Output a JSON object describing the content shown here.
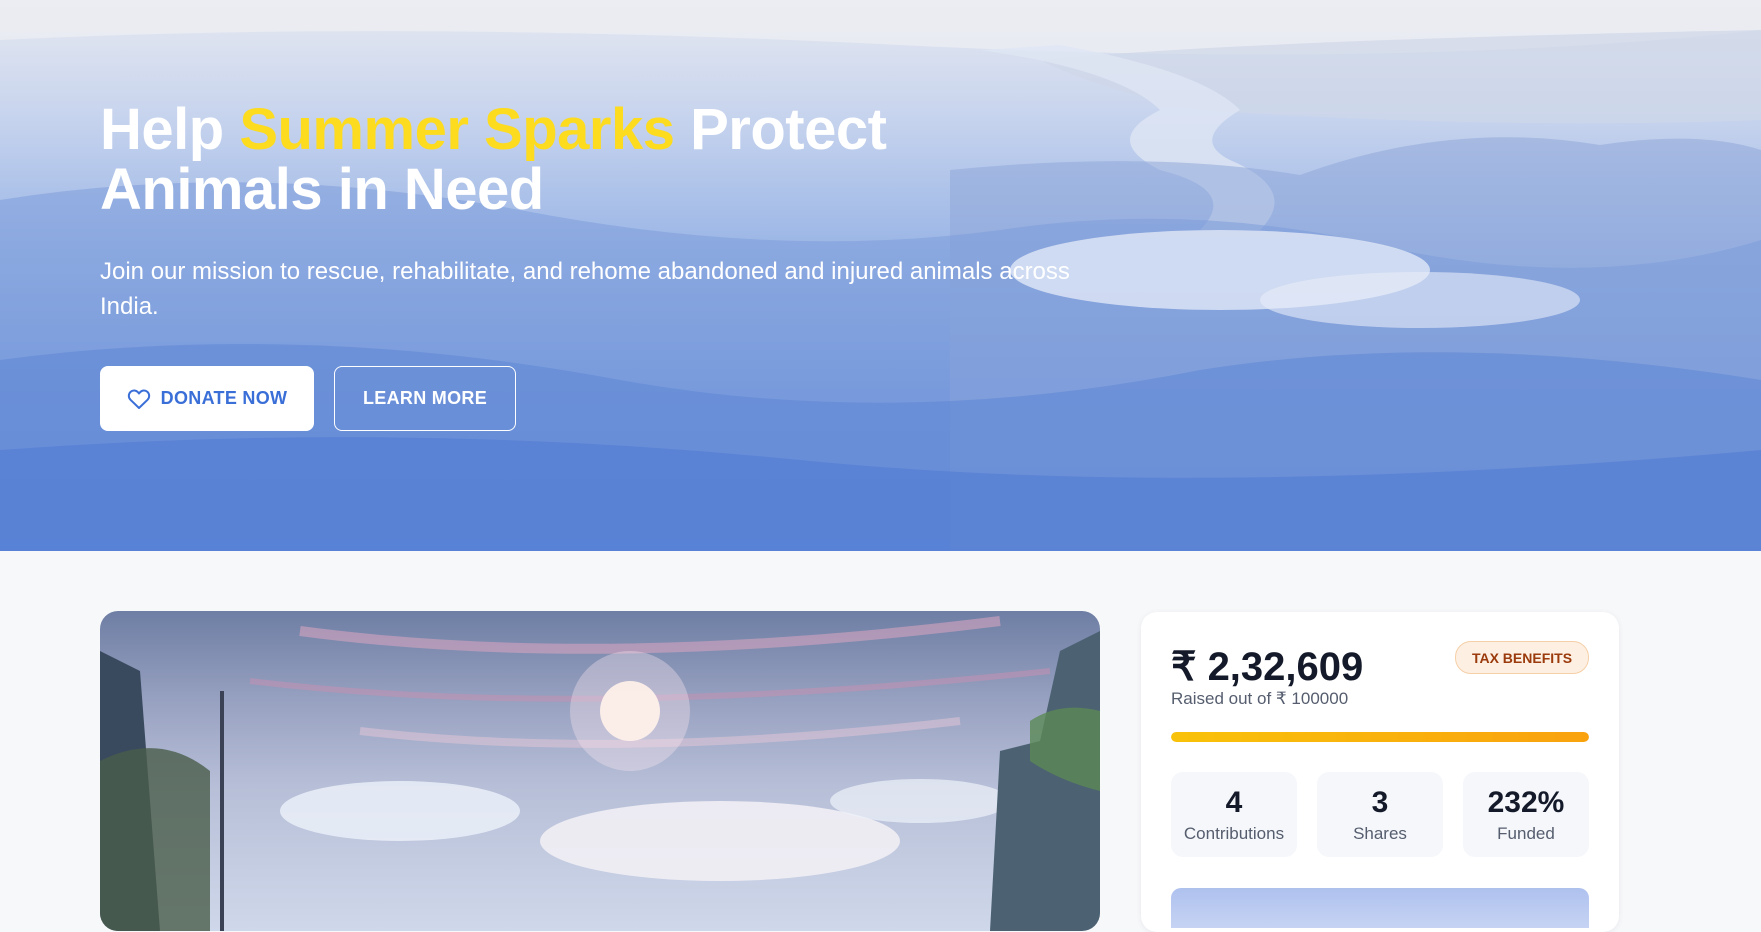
{
  "hero": {
    "title_prefix": "Help ",
    "title_accent": "Summer Sparks",
    "title_suffix": " Protect Animals in Need",
    "subtitle": "Join our mission to rescue, rehabilitate, and rehome abandoned and injured animals across India.",
    "donate_label": "DONATE NOW",
    "learn_label": "LEARN MORE",
    "colors": {
      "accent": "#fddb1f",
      "button_text": "#3b6fd8"
    }
  },
  "campaign": {
    "amount_raised": "₹ 2,32,609",
    "raised_text": "Raised out of ₹ 100000",
    "badge": "TAX BENEFITS",
    "progress_fraction": 1.0,
    "stats": [
      {
        "value": "4",
        "label": "Contributions"
      },
      {
        "value": "3",
        "label": "Shares"
      },
      {
        "value": "232%",
        "label": "Funded"
      }
    ],
    "colors": {
      "progress": "#f9b50c",
      "badge_text": "#9b3a0c"
    }
  },
  "icons": {
    "donate_icon": "heart-icon"
  }
}
